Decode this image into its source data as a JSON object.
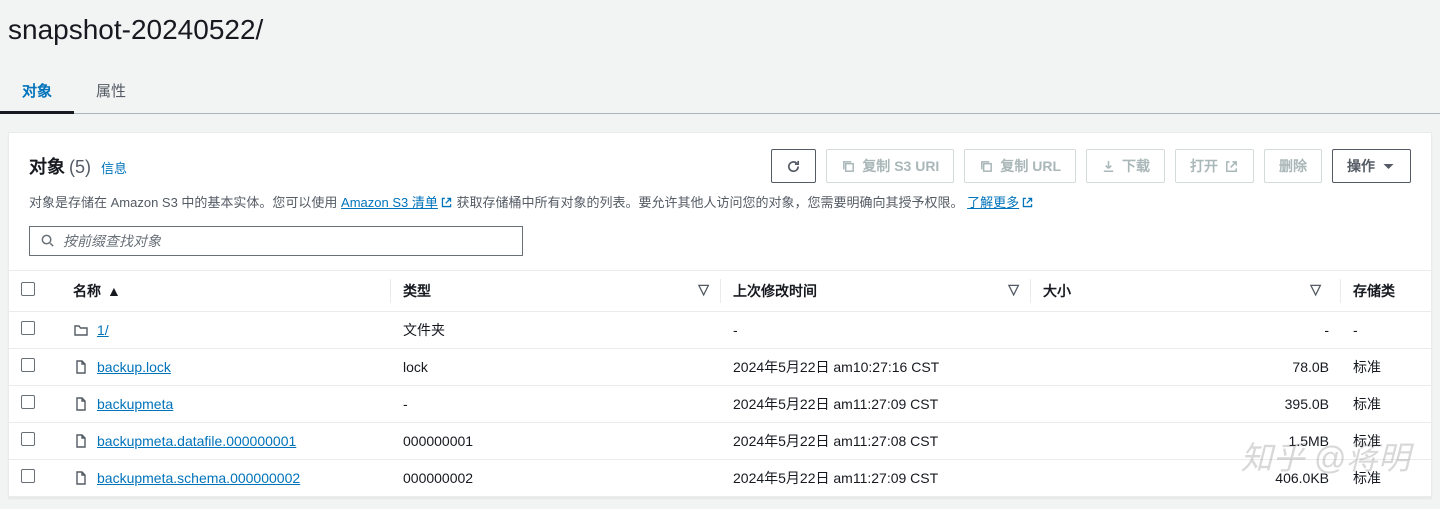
{
  "title": "snapshot-20240522/",
  "tabs": {
    "objects": "对象",
    "properties": "属性"
  },
  "panel": {
    "title": "对象",
    "count": "(5)",
    "info": "信息",
    "desc1": "对象是存储在 Amazon S3 中的基本实体。您可以使用 ",
    "desc_link1": "Amazon S3 清单",
    "desc2": "获取存储桶中所有对象的列表。要允许其他人访问您的对象，您需要明确向其授予权限。",
    "desc_link2": "了解更多"
  },
  "toolbar": {
    "copy_s3": "复制 S3 URI",
    "copy_url": "复制 URL",
    "download": "下载",
    "open": "打开",
    "delete": "删除",
    "actions": "操作"
  },
  "search": {
    "placeholder": "按前缀查找对象"
  },
  "columns": {
    "name": "名称",
    "type": "类型",
    "modified": "上次修改时间",
    "size": "大小",
    "storage": "存储类"
  },
  "rows": [
    {
      "icon": "folder",
      "name": "1/",
      "type": "文件夹",
      "modified": "-",
      "size": "-",
      "storage": "-"
    },
    {
      "icon": "file",
      "name": "backup.lock",
      "type": "lock",
      "modified": "2024年5月22日 am10:27:16 CST",
      "size": "78.0B",
      "storage": "标准"
    },
    {
      "icon": "file",
      "name": "backupmeta",
      "type": "-",
      "modified": "2024年5月22日 am11:27:09 CST",
      "size": "395.0B",
      "storage": "标准"
    },
    {
      "icon": "file",
      "name": "backupmeta.datafile.000000001",
      "type": "000000001",
      "modified": "2024年5月22日 am11:27:08 CST",
      "size": "1.5MB",
      "storage": "标准"
    },
    {
      "icon": "file",
      "name": "backupmeta.schema.000000002",
      "type": "000000002",
      "modified": "2024年5月22日 am11:27:09 CST",
      "size": "406.0KB",
      "storage": "标准"
    }
  ],
  "watermark": "知乎 @蒋明"
}
